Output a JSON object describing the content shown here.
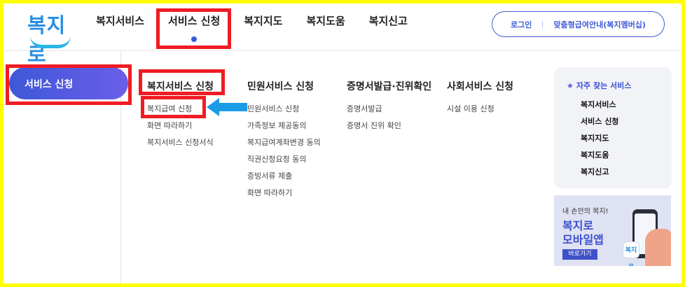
{
  "logo": {
    "text": "복지로"
  },
  "gnb": {
    "items": [
      "복지서비스",
      "서비스 신청",
      "복지지도",
      "복지도움",
      "복지신고"
    ],
    "active_index": 1
  },
  "util": {
    "login": "로그인",
    "guide": "맞춤형급여안내(복지멤버십)"
  },
  "side": {
    "active_label": "서비스 신청"
  },
  "columns": [
    {
      "title": "복지서비스 신청",
      "items": [
        "복지급여 신청",
        "화면 따라하기",
        "복지서비스 신청서식"
      ]
    },
    {
      "title": "민원서비스 신청",
      "items": [
        "민원서비스 신청",
        "가족정보 제공동의",
        "복지급여계좌변경 동의",
        "직권신청요청 동의",
        "증빙서류 제출",
        "화면 따라하기"
      ]
    },
    {
      "title": "증명서발급·진위확인",
      "items": [
        "증명서발급",
        "증명서 진위 확인"
      ]
    },
    {
      "title": "사회서비스 신청",
      "items": [
        "시설 이용 신청"
      ]
    }
  ],
  "quick": {
    "title": "자주 찾는 서비스",
    "items": [
      "복지서비스",
      "서비스 신청",
      "복지지도",
      "복지도움",
      "복지신고"
    ]
  },
  "banner": {
    "small": "내 손안의 복지!",
    "line1": "복지로",
    "line2": "모바일앱",
    "button": "바로가기",
    "app_label": "복지로"
  },
  "colors": {
    "accent": "#3f5bd4",
    "highlight": "#ee1c24",
    "border": "#ffff00",
    "arrow": "#1a9be6"
  }
}
